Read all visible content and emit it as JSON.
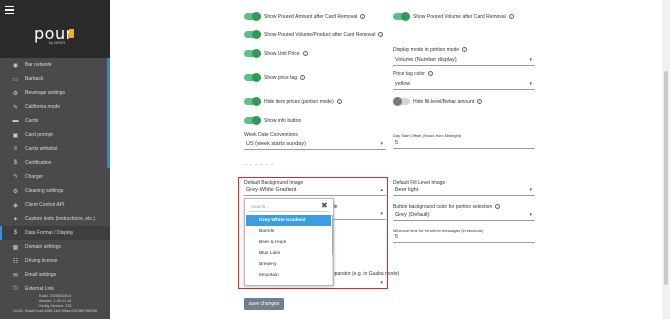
{
  "app": {
    "logo_text": "pour",
    "logo_sub": "by BEER"
  },
  "sidebar": {
    "items": [
      {
        "icon": "wifi",
        "glyph": "◉",
        "label": "Bar network"
      },
      {
        "icon": "badge",
        "glyph": "▭",
        "label": "Barback"
      },
      {
        "icon": "gear",
        "glyph": "⚙",
        "label": "Beverage settings"
      },
      {
        "icon": "wrench",
        "glyph": "✎",
        "label": "California mode"
      },
      {
        "icon": "card",
        "glyph": "▬",
        "label": "Cards"
      },
      {
        "icon": "card-prompt",
        "glyph": "▣",
        "label": "Card prompt"
      },
      {
        "icon": "list",
        "glyph": "≡",
        "label": "Cards whitelist"
      },
      {
        "icon": "dollar",
        "glyph": "$",
        "label": "Certification"
      },
      {
        "icon": "bolt",
        "glyph": "ϟ",
        "label": "Charger"
      },
      {
        "icon": "gear2",
        "glyph": "⚙",
        "label": "Cleaning settings"
      },
      {
        "icon": "chip",
        "glyph": "◈",
        "label": "Client Control API"
      },
      {
        "icon": "custom",
        "glyph": "✦",
        "label": "Custom texts (instructions, etc.)"
      },
      {
        "icon": "dollar2",
        "glyph": "$",
        "label": "Data Format / Display"
      },
      {
        "icon": "server",
        "glyph": "▦",
        "label": "Domain settings"
      },
      {
        "icon": "license",
        "glyph": "☷",
        "label": "Driving license"
      },
      {
        "icon": "mail",
        "glyph": "✉",
        "label": "Email settings"
      },
      {
        "icon": "link",
        "glyph": "⎋",
        "label": "External Link"
      }
    ],
    "active_index": 12,
    "build": [
      "Build: 2025052815",
      "Version: 1.49.21.16",
      "Config Version: 232",
      "UUID: 90a2e7ca4-60f5-11ef-95aa-001389758298"
    ]
  },
  "settings": {
    "show_poured_amount": "Show Poured Amount after Card Removal",
    "show_poured_volume": "Show Poured Volume after Card Removal",
    "show_poured_volume_product": "Show Poured Volume/Product after Card Removal",
    "show_unit_price": "Show Unit Price",
    "display_mode_label": "Display mode in portion mode",
    "display_mode_value": "Volume (Number display)",
    "show_price_tag": "Show price tag",
    "price_tag_color_label": "Price tag color",
    "price_tag_color_value": "yellow",
    "hide_item_prices": "Hide item prices (portion mode)",
    "hide_fill_level": "Hide fill-level/Bebar amount",
    "show_info_button": "Show info button",
    "week_date_label": "Week Date Conventions",
    "week_date_value": "US (week starts sunday)",
    "day_start_label": "Day Start Offset (Hours from Midnight)",
    "day_start_value": "5",
    "default_bg_label": "Default Background Image",
    "default_bg_value": "Grey-White Gradient",
    "default_fill_label": "Default Fill Level Image",
    "default_fill_value": "Beer light",
    "button_bg_label": "Button background color for portion selection",
    "button_bg_value": "Grey (Default)",
    "min_time_label": "Minimum time for error/info messages (in seconds)",
    "min_time_value": "5",
    "partial_label_tail": "de",
    "bottom_hint": "eparator (e.g. in Guaba mode)",
    "save_label": "save changes"
  },
  "dropdown": {
    "search_placeholder": "Search...",
    "options": [
      "Grey-White Gradient",
      "Barrels",
      "Beer & Hops",
      "Blue Lake",
      "Brewery",
      "Mountain"
    ],
    "selected_index": 0
  }
}
